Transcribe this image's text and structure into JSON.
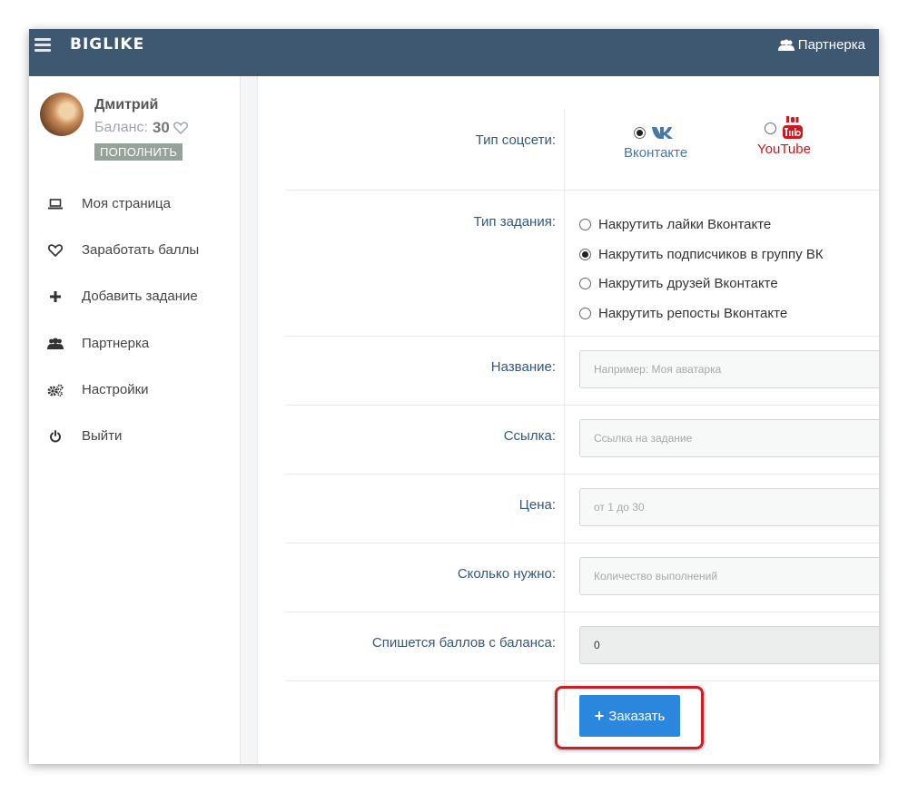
{
  "app": {
    "brand": "BIGLIKE",
    "partner_link": "Партнерка"
  },
  "user": {
    "name": "Дмитрий",
    "balance_label": "Баланс:",
    "balance_value": "30",
    "topup_label": "ПОПОЛНИТЬ"
  },
  "sidebar": {
    "items": [
      {
        "label": "Моя страница",
        "icon": "laptop-icon"
      },
      {
        "label": "Заработать баллы",
        "icon": "heart-icon"
      },
      {
        "label": "Добавить задание",
        "icon": "plus-icon"
      },
      {
        "label": "Партнерка",
        "icon": "users-icon"
      },
      {
        "label": "Настройки",
        "icon": "gears-icon"
      },
      {
        "label": "Выйти",
        "icon": "power-icon"
      }
    ]
  },
  "form": {
    "social_type": {
      "label": "Тип соцсети:",
      "options": [
        {
          "label": "Вконтакте",
          "selected": true,
          "color": "#4a76a8",
          "icon": "vk-icon"
        },
        {
          "label": "YouTube",
          "selected": false,
          "color": "#cc181e",
          "icon": "youtube-icon"
        }
      ]
    },
    "task_type": {
      "label": "Тип задания:",
      "options": [
        {
          "label": "Накрутить лайки Вконтакте",
          "selected": false
        },
        {
          "label": "Накрутить подписчиков в группу ВК",
          "selected": true
        },
        {
          "label": "Накрутить друзей Вконтакте",
          "selected": false
        },
        {
          "label": "Накрутить репосты Вконтакте",
          "selected": false
        }
      ]
    },
    "name": {
      "label": "Название:",
      "placeholder": "Например: Моя аватарка"
    },
    "link": {
      "label": "Ссылка:",
      "placeholder": "Ссылка на задание"
    },
    "price": {
      "label": "Цена:",
      "placeholder": "от 1 до 30"
    },
    "count": {
      "label": "Сколько нужно:",
      "placeholder": "Количество выполнений"
    },
    "deduct": {
      "label": "Спишется баллов с баланса:",
      "value": "0"
    },
    "submit_label": "Заказать"
  },
  "colors": {
    "topbar": "#3f5872",
    "accent_button": "#2b87de",
    "highlight": "#d11b25",
    "label": "#34587b"
  }
}
